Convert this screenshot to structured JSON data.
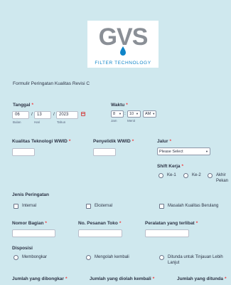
{
  "logo": {
    "letters": "GVS",
    "tagline": "FILTER TECHNOLOGY"
  },
  "form_title": "Formulir Peringatan Kualitas Revisi C",
  "tanggal": {
    "label": "Tanggal",
    "required": "*",
    "day": "06",
    "month": "13",
    "year": "2023",
    "sep1": "/",
    "sep2": "/",
    "sub_day": "Bulan",
    "sub_month": "Hari",
    "sub_year": "Tahun"
  },
  "waktu": {
    "label": "Waktu",
    "required": "*",
    "hour": "8",
    "minute": "10",
    "ampm": "AM",
    "colon": ":",
    "sub_hour": "Jam",
    "sub_minute": "Menit"
  },
  "kualitas": {
    "label": "Kualitas Teknologi WWID",
    "required": "*",
    "value": ""
  },
  "penyelidik": {
    "label": "Penyelidik WWID",
    "required": "*",
    "value": ""
  },
  "jalur": {
    "label": "Jalur",
    "required": "*",
    "value": "Please Select"
  },
  "shift": {
    "label": "Shift Kerja",
    "required": "*",
    "options": [
      "Ke-1",
      "Ke-2",
      "Akhir",
      "Pekan"
    ]
  },
  "jenis": {
    "label": "Jenis Peringatan",
    "options": [
      "Internal",
      "Eksternal",
      "Masalah Kualitas Berulang"
    ]
  },
  "nomor_bagian": {
    "label": "Nomor Bagian",
    "required": "*",
    "value": ""
  },
  "no_pesanan": {
    "label": "No. Pesanan Toko",
    "required": "*",
    "value": ""
  },
  "peralatan": {
    "label": "Peralatan yang terlibat",
    "required": "*",
    "value": ""
  },
  "disposisi": {
    "label": "Disposisi",
    "options": [
      "Membongkar",
      "Mengolah kembali",
      "Ditunda untuk Tinjauan Lebih",
      "Lanjut"
    ]
  },
  "jumlah_dibongkar": {
    "label": "Jumlah yang dibongkar",
    "required": "*"
  },
  "jumlah_diolah": {
    "label": "Jumlah yang diolah kembali",
    "required": "*"
  },
  "jumlah_ditunda": {
    "label": "Jumlah yang ditunda",
    "required": "*"
  },
  "colors": {
    "accent": "#0e84c8",
    "required": "#f23a3c",
    "background": "#cfe8ee"
  },
  "icons": {
    "calendar": "calendar-icon",
    "chevron": "chevron-down-icon"
  }
}
